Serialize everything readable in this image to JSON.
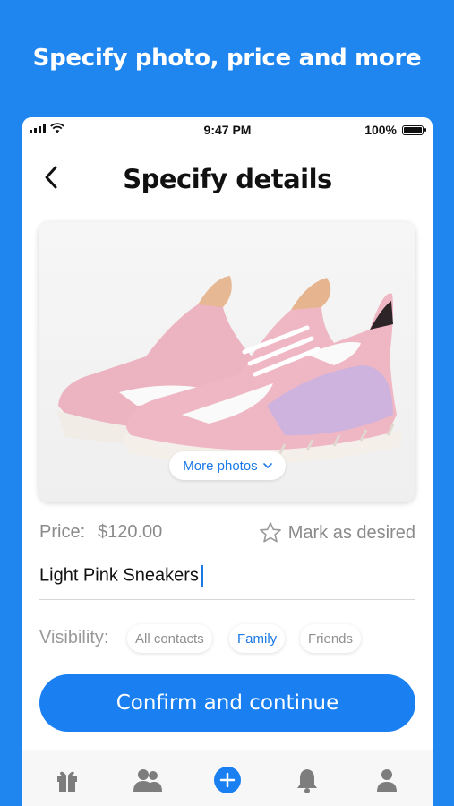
{
  "promo": {
    "headline": "Specify photo, price and more"
  },
  "status_bar": {
    "time": "9:47 PM",
    "battery": "100%",
    "battery_level": 1.0
  },
  "nav": {
    "title": "Specify details",
    "back_icon": "chevron-left-icon"
  },
  "photo": {
    "subject": "pink-sneakers-image",
    "more_photos_label": "More photos",
    "more_photos_icon": "chevron-down-icon"
  },
  "price": {
    "label": "Price:",
    "value": "$120.00"
  },
  "desired": {
    "label": "Mark as desired",
    "icon": "star-outline-icon"
  },
  "item_name": {
    "value": "Light Pink Sneakers"
  },
  "visibility": {
    "label": "Visibility:",
    "options": [
      "All contacts",
      "Family",
      "Friends"
    ],
    "selected": "Family"
  },
  "confirm": {
    "label": "Confirm and continue"
  },
  "tabbar": {
    "tabs": [
      "gift-icon",
      "contacts-icon",
      "add-icon",
      "bell-icon",
      "profile-icon"
    ],
    "active": "add-icon"
  },
  "colors": {
    "brand_blue": "#1f86f0",
    "accent": "#1a80f2",
    "muted_text": "#8a8a8a",
    "icon_gray": "#7d7d7d"
  }
}
